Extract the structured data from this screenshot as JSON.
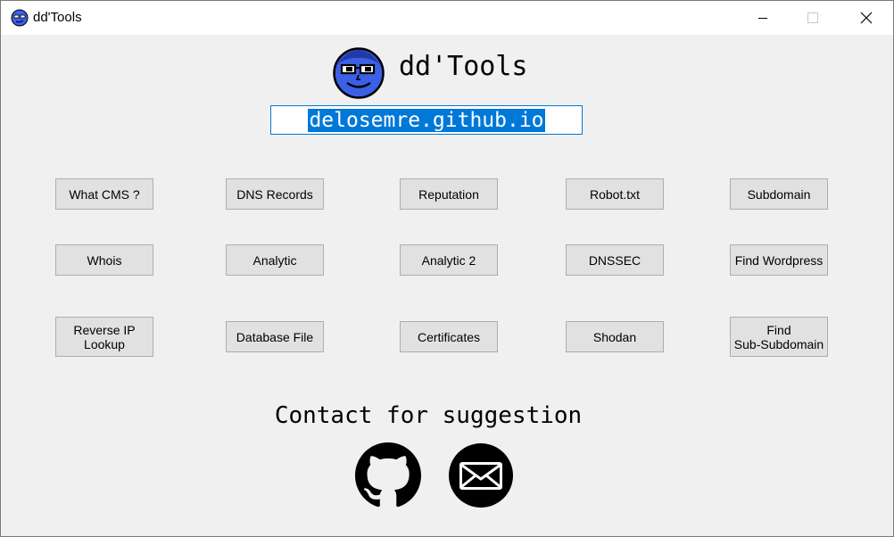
{
  "window": {
    "title": "dd'Tools"
  },
  "header": {
    "app_title": "dd'Tools",
    "url": "delosemre.github.io"
  },
  "buttons": [
    {
      "label": "What CMS ?"
    },
    {
      "label": "DNS Records"
    },
    {
      "label": "Reputation"
    },
    {
      "label": "Robot.txt"
    },
    {
      "label": "Subdomain"
    },
    {
      "label": "Whois"
    },
    {
      "label": "Analytic"
    },
    {
      "label": "Analytic 2"
    },
    {
      "label": "DNSSEC"
    },
    {
      "label": "Find Wordpress"
    },
    {
      "label": "Reverse IP\nLookup"
    },
    {
      "label": "Database File"
    },
    {
      "label": "Certificates"
    },
    {
      "label": "Shodan"
    },
    {
      "label": "Find\nSub-Subdomain"
    }
  ],
  "footer": {
    "contact_text": "Contact for suggestion",
    "icons": [
      "github-icon",
      "mail-icon"
    ]
  },
  "colors": {
    "accent": "#0078d7",
    "logo_face": "#3c5fe6",
    "button_face": "#e1e1e1",
    "window_bg": "#f0f0f0"
  }
}
